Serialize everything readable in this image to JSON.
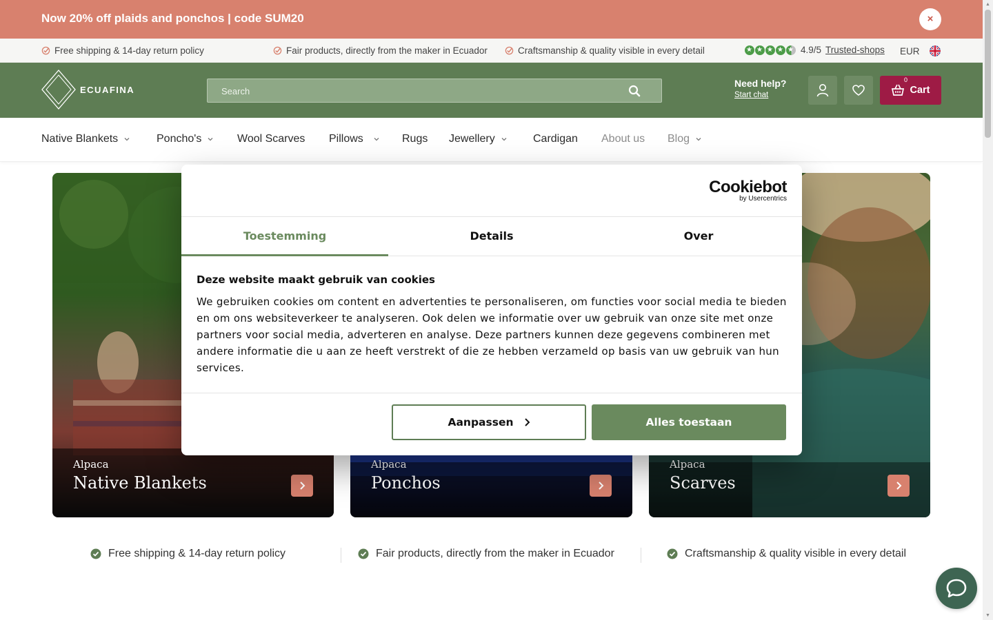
{
  "announcement": {
    "text": "Now 20% off plaids and ponchos | code SUM20",
    "close_label": "×"
  },
  "usp_bar": {
    "items": [
      "Free shipping & 14-day return policy",
      "Fair products, directly from the maker in Ecuador",
      "Craftsmanship & quality visible in every detail"
    ],
    "rating_score": "4.9",
    "rating_max": "/5",
    "rating_value": 4.9,
    "rating_link": "Trusted-shops",
    "currency": "EUR"
  },
  "header": {
    "logo_text": "ECUAFINA",
    "search_placeholder": "Search",
    "help_title": "Need help?",
    "help_link": "Start chat",
    "cart_label": "Cart",
    "cart_count": "0"
  },
  "nav": {
    "items": [
      {
        "label": "Native Blankets"
      },
      {
        "label": "Poncho's"
      },
      {
        "label": "Wool Scarves"
      },
      {
        "label": "Pillows"
      },
      {
        "label": "Rugs"
      },
      {
        "label": "Jewellery"
      },
      {
        "label": "Cardigan"
      },
      {
        "label": "About us"
      },
      {
        "label": "Blog"
      }
    ]
  },
  "cards": [
    {
      "subtitle": "Alpaca",
      "title": "Native Blankets"
    },
    {
      "subtitle": "Alpaca",
      "title": "Ponchos"
    },
    {
      "subtitle": "Alpaca",
      "title": "Scarves"
    }
  ],
  "bottom_usp": [
    "Free shipping & 14-day return policy",
    "Fair products, directly from the maker in Ecuador",
    "Craftsmanship & quality visible in every detail"
  ],
  "cookie": {
    "logo_main": "Cookiebot",
    "logo_sub": "by Usercentrics",
    "tabs": [
      "Toestemming",
      "Details",
      "Over"
    ],
    "heading": "Deze website maakt gebruik van cookies",
    "body": "We gebruiken cookies om content en advertenties te personaliseren, om functies voor social media te bieden en om ons websiteverkeer te analyseren. Ook delen we informatie over uw gebruik van onze site met onze partners voor social media, adverteren en analyse. Deze partners kunnen deze gegevens combineren met andere informatie die u aan ze heeft verstrekt of die ze hebben verzameld op basis van uw gebruik van hun services.",
    "customize_label": "Aanpassen",
    "allow_all_label": "Alles toestaan"
  },
  "colors": {
    "announcement": "#d8816e",
    "header_green": "#5e7d54",
    "cart_burgundy": "#9e1b45",
    "cookie_accent": "#6a8a5e",
    "chat_button": "#3e6552"
  },
  "icons": {
    "announcement_close": "close-icon",
    "usp_check": "check-icon",
    "search": "search-icon",
    "account": "user-icon",
    "wishlist": "heart-icon",
    "cart": "basket-icon",
    "nav_dropdown": "chevron-down-icon",
    "card_arrow": "chevron-right-icon",
    "chat": "chat-bubble-icon",
    "language": "uk-flag-icon"
  }
}
